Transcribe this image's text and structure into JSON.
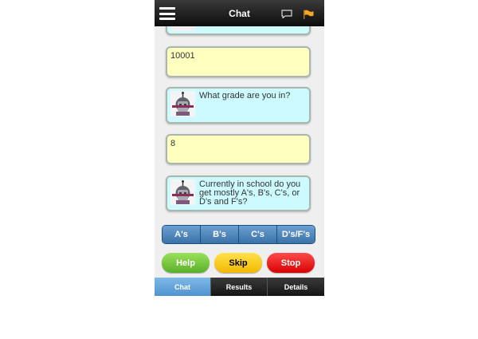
{
  "header": {
    "title": "Chat",
    "icons": [
      "menu-icon",
      "chat-bubble-icon",
      "flag-icon"
    ]
  },
  "messages": [
    {
      "from": "user",
      "text": "10001"
    },
    {
      "from": "bot",
      "text": "What grade are you in?"
    },
    {
      "from": "user",
      "text": "8"
    },
    {
      "from": "bot",
      "text": "Currently in school do you get mostly A's, B's, C's, or D's and F's?"
    }
  ],
  "answer_options": [
    "A's",
    "B's",
    "C's",
    "D's/F's"
  ],
  "actions": {
    "help": "Help",
    "skip": "Skip",
    "stop": "Stop"
  },
  "tabs": [
    {
      "label": "Chat",
      "active": true
    },
    {
      "label": "Results",
      "active": false
    },
    {
      "label": "Details",
      "active": false
    }
  ],
  "colors": {
    "user_bubble": "#ffffbf",
    "bot_bubble": "#cdfaff",
    "accent": "#4f93cf"
  }
}
